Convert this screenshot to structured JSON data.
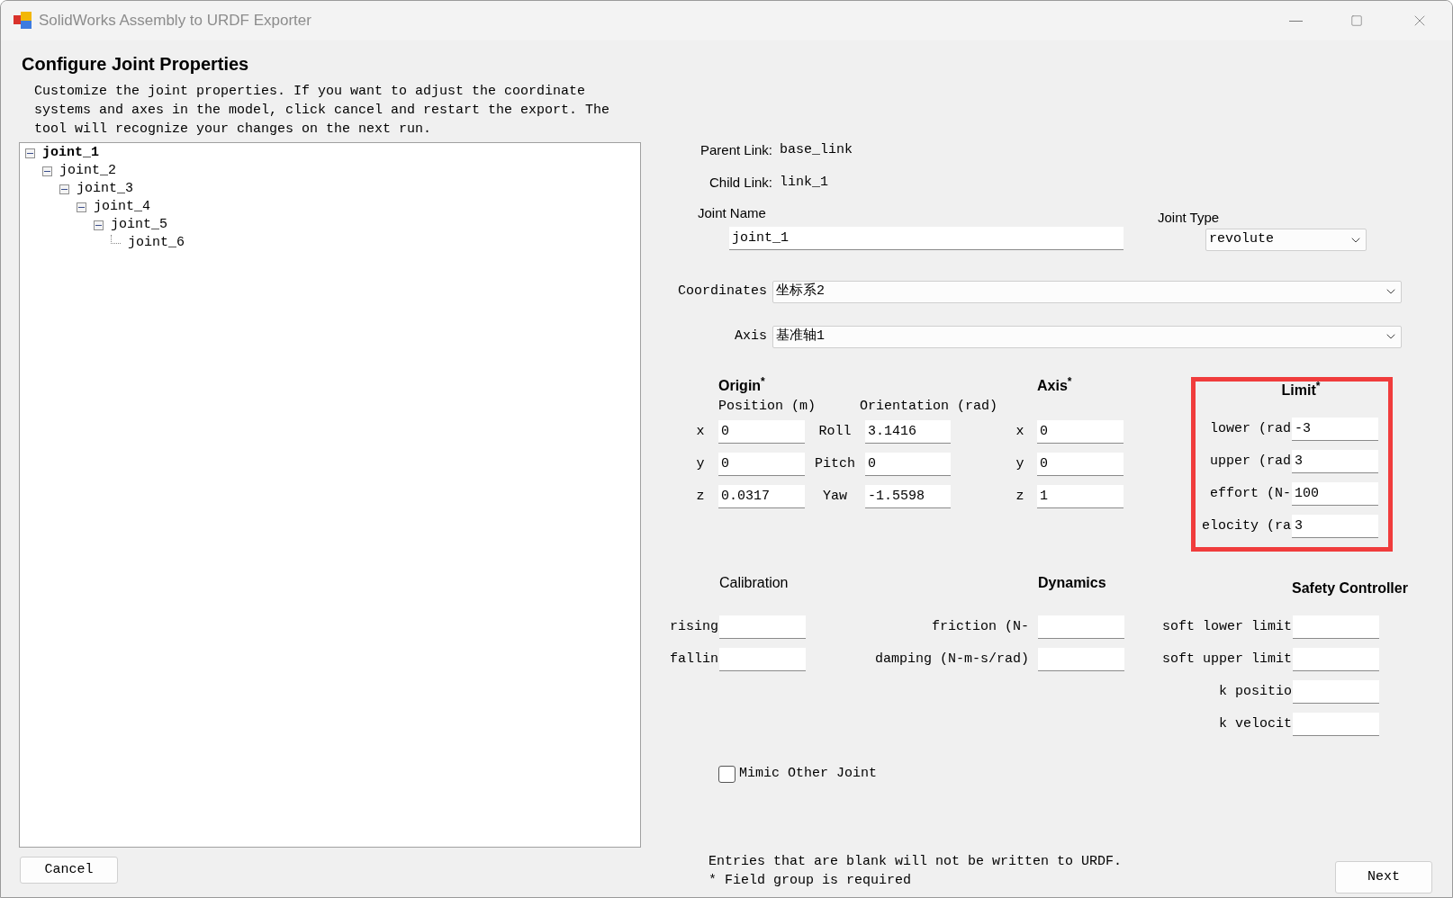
{
  "window": {
    "title": "SolidWorks Assembly to URDF Exporter"
  },
  "heading": "Configure Joint Properties",
  "description": "Customize the joint properties. If you want to adjust the coordinate systems and axes in the model, click cancel and restart the export. The tool will recognize your changes on the next run.",
  "tree": [
    {
      "label": "joint_1",
      "selected": true,
      "expanded": true,
      "children": [
        {
          "label": "joint_2",
          "selected": false,
          "expanded": true,
          "children": [
            {
              "label": "joint_3",
              "selected": false,
              "expanded": true,
              "children": [
                {
                  "label": "joint_4",
                  "selected": false,
                  "expanded": true,
                  "children": [
                    {
                      "label": "joint_5",
                      "selected": false,
                      "expanded": true,
                      "children": [
                        {
                          "label": "joint_6",
                          "selected": false
                        }
                      ]
                    }
                  ]
                }
              ]
            }
          ]
        }
      ]
    }
  ],
  "cancel_button": "Cancel",
  "parent_link": {
    "label": "Parent Link:",
    "value": "base_link"
  },
  "child_link": {
    "label": "Child Link:",
    "value": "link_1"
  },
  "joint_name": {
    "label": "Joint Name",
    "value": "joint_1"
  },
  "joint_type": {
    "label": "Joint Type",
    "value": "revolute"
  },
  "coordinates": {
    "label": "Coordinates",
    "value": "坐标系2"
  },
  "axis_select": {
    "label": "Axis",
    "value": "基准轴1"
  },
  "origin": {
    "title": "Origin$^{*}$",
    "position_label": "Position (m)",
    "orientation_label": "Orientation (rad)",
    "position": [
      {
        "label": "x",
        "value": "0"
      },
      {
        "label": "y",
        "value": "0"
      },
      {
        "label": "z",
        "value": "0.0317"
      }
    ],
    "orientation": [
      {
        "label": "Roll",
        "value": "3.1416"
      },
      {
        "label": "Pitch",
        "value": "0"
      },
      {
        "label": "Yaw",
        "value": "-1.5598"
      }
    ]
  },
  "axis": {
    "title": "Axis$^{*}$",
    "fields": [
      {
        "label": "x",
        "value": "0"
      },
      {
        "label": "y",
        "value": "0"
      },
      {
        "label": "z",
        "value": "1"
      }
    ]
  },
  "limit": {
    "title": "Limit$^{*}$",
    "highlighted": true,
    "fields": [
      {
        "label": "lower (rad",
        "value": "-3"
      },
      {
        "label": "upper (rad",
        "value": "3"
      },
      {
        "label": "effort (N-",
        "value": "100"
      },
      {
        "label": "elocity (ra",
        "value": "3"
      }
    ]
  },
  "calibration": {
    "title": "Calibration",
    "fields": [
      {
        "label": "rising"
      },
      {
        "label": "fallin"
      }
    ]
  },
  "dynamics": {
    "title": "Dynamics",
    "fields": [
      {
        "label": "friction (N-"
      },
      {
        "label": "damping (N-m-s/rad)"
      }
    ]
  },
  "safety_controller": {
    "title": "Safety Controller",
    "fields": [
      {
        "label": "soft lower limit"
      },
      {
        "label": "soft upper limit"
      },
      {
        "label": "k positio"
      },
      {
        "label": "k velocit"
      }
    ]
  },
  "mimic": {
    "label": "Mimic Other Joint",
    "checked": false
  },
  "footer_notes": [
    "Entries that are blank will not be written to URDF.",
    "* Field group is required"
  ],
  "next_button": "Next"
}
